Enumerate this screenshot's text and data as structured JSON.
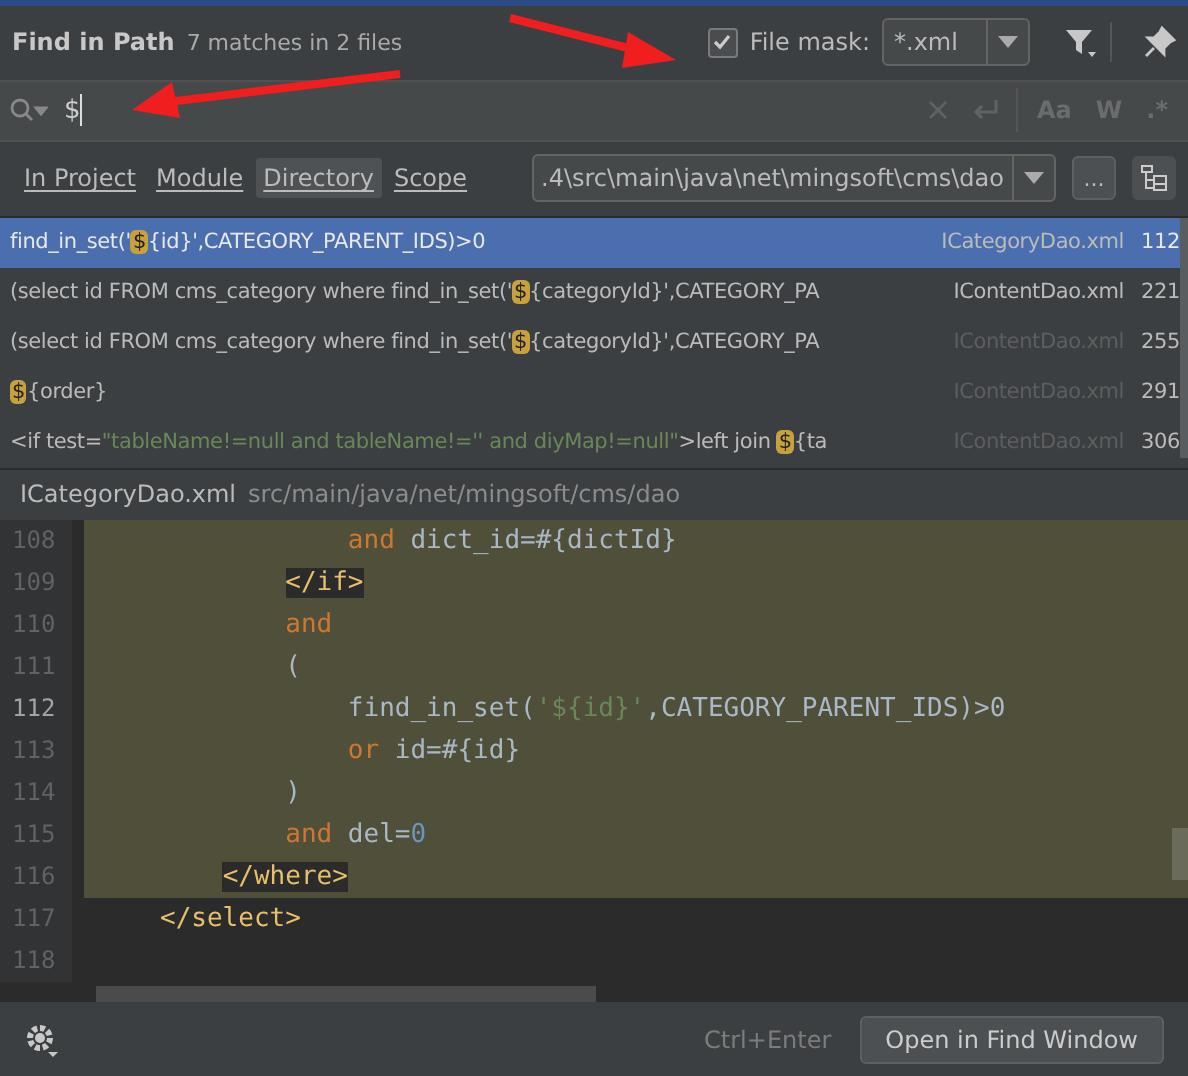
{
  "header": {
    "title": "Find in Path",
    "summary": "7 matches in 2 files",
    "file_mask": {
      "label": "File mask:",
      "checked": true,
      "value": "*.xml"
    }
  },
  "search": {
    "value": "$",
    "options": [
      "Aa",
      "W",
      ".*"
    ]
  },
  "scope_tabs": [
    {
      "label": "In Project",
      "selected": false
    },
    {
      "label": "Module",
      "selected": false
    },
    {
      "label": "Directory",
      "selected": true
    },
    {
      "label": "Scope",
      "selected": false
    }
  ],
  "directory": {
    "value": ".4\\src\\main\\java\\net\\mingsoft\\cms\\dao",
    "browse": "..."
  },
  "results": [
    {
      "selected": true,
      "file_dimmed": false,
      "file": "ICategoryDao.xml",
      "line": "112",
      "segments": [
        {
          "kind": "plain",
          "text": "find_in_set('"
        },
        {
          "kind": "match",
          "text": "$"
        },
        {
          "kind": "plain",
          "text": "{id}',CATEGORY_PARENT_IDS)>0"
        }
      ]
    },
    {
      "selected": false,
      "file_dimmed": false,
      "file": "IContentDao.xml",
      "line": "221",
      "segments": [
        {
          "kind": "plain",
          "text": "(select id FROM cms_category where find_in_set('"
        },
        {
          "kind": "match",
          "text": "$"
        },
        {
          "kind": "plain",
          "text": "{categoryId}',CATEGORY_PA"
        }
      ]
    },
    {
      "selected": false,
      "file_dimmed": true,
      "file": "IContentDao.xml",
      "line": "255",
      "segments": [
        {
          "kind": "plain",
          "text": "(select id FROM cms_category where find_in_set('"
        },
        {
          "kind": "match",
          "text": "$"
        },
        {
          "kind": "plain",
          "text": "{categoryId}',CATEGORY_PA"
        }
      ]
    },
    {
      "selected": false,
      "file_dimmed": true,
      "file": "IContentDao.xml",
      "line": "291",
      "segments": [
        {
          "kind": "match",
          "text": "$"
        },
        {
          "kind": "plain",
          "text": "{order}"
        }
      ]
    },
    {
      "selected": false,
      "file_dimmed": true,
      "file": "IContentDao.xml",
      "line": "306",
      "segments": [
        {
          "kind": "plain",
          "text": "<if test="
        },
        {
          "kind": "str",
          "text": "\"tableName!=null and tableName!='' and diyMap!=null\""
        },
        {
          "kind": "plain",
          "text": ">left join "
        },
        {
          "kind": "match",
          "text": "$"
        },
        {
          "kind": "plain",
          "text": "{ta"
        }
      ]
    }
  ],
  "preview": {
    "file": "ICategoryDao.xml",
    "path": "src/main/java/net/mingsoft/cms/dao",
    "lines": [
      {
        "number": "108",
        "current": false,
        "highlighted": true,
        "segments": [
          {
            "kind": "kw",
            "text": "            and"
          },
          {
            "kind": "plain",
            "text": " dict_id=#{dictId}"
          }
        ]
      },
      {
        "number": "109",
        "current": false,
        "highlighted": true,
        "segments": [
          {
            "kind": "tag",
            "text": "        </if>"
          }
        ]
      },
      {
        "number": "110",
        "current": false,
        "highlighted": true,
        "segments": [
          {
            "kind": "kw",
            "text": "        and"
          }
        ]
      },
      {
        "number": "111",
        "current": false,
        "highlighted": true,
        "segments": [
          {
            "kind": "plain",
            "text": "        ("
          }
        ]
      },
      {
        "number": "112",
        "current": true,
        "highlighted": true,
        "segments": [
          {
            "kind": "plain",
            "text": "            find_in_set("
          },
          {
            "kind": "str",
            "text": "'${id}'"
          },
          {
            "kind": "plain",
            "text": ",CATEGORY_PARENT_IDS)>0"
          }
        ]
      },
      {
        "number": "113",
        "current": false,
        "highlighted": true,
        "segments": [
          {
            "kind": "kw",
            "text": "            or"
          },
          {
            "kind": "plain",
            "text": " id=#{id}"
          }
        ]
      },
      {
        "number": "114",
        "current": false,
        "highlighted": true,
        "segments": [
          {
            "kind": "plain",
            "text": "        )"
          }
        ]
      },
      {
        "number": "115",
        "current": false,
        "highlighted": true,
        "segments": [
          {
            "kind": "kw",
            "text": "        and"
          },
          {
            "kind": "plain",
            "text": " del="
          },
          {
            "kind": "num",
            "text": "0"
          }
        ]
      },
      {
        "number": "116",
        "current": false,
        "highlighted": true,
        "segments": [
          {
            "kind": "tag",
            "text": "    </where>"
          }
        ]
      },
      {
        "number": "117",
        "current": false,
        "highlighted": false,
        "segments": [
          {
            "kind": "tag",
            "text": "</select>"
          }
        ]
      },
      {
        "number": "118",
        "current": false,
        "highlighted": false
      }
    ]
  },
  "footer": {
    "shortcut": "Ctrl+Enter",
    "button": "Open in Find Window"
  }
}
